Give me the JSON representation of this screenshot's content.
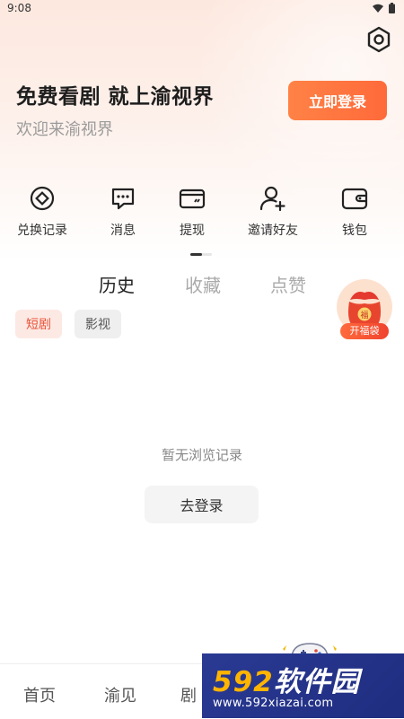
{
  "status_bar": {
    "time": "9:08"
  },
  "header": {
    "promo_title": "免费看剧 就上渝视界",
    "promo_subtitle": "欢迎来渝视界",
    "login_button": "立即登录"
  },
  "shortcuts": [
    {
      "label": "兑换记录",
      "icon": "coin-icon"
    },
    {
      "label": "消息",
      "icon": "message-icon"
    },
    {
      "label": "提现",
      "icon": "card-icon"
    },
    {
      "label": "邀请好友",
      "icon": "add-user-icon"
    },
    {
      "label": "钱包",
      "icon": "wallet-icon"
    }
  ],
  "tabs": [
    {
      "label": "历史",
      "active": true
    },
    {
      "label": "收藏",
      "active": false
    },
    {
      "label": "点赞",
      "active": false
    }
  ],
  "filters": [
    {
      "label": "短剧",
      "active": true
    },
    {
      "label": "影视",
      "active": false
    }
  ],
  "floating_badge": {
    "label": "开福袋",
    "mark": "福"
  },
  "empty_state": {
    "message": "暂无浏览记录",
    "button": "去登录"
  },
  "bottom_nav": [
    {
      "label": "首页"
    },
    {
      "label": "渝见"
    },
    {
      "label": "剧"
    }
  ],
  "watermark": {
    "number": "592",
    "text": "软件园",
    "url": "www.592xiazai.com"
  },
  "colors": {
    "accent": "#ff7340",
    "chip_active_bg": "#fde9e4",
    "chip_active_text": "#e8543a",
    "watermark_bg": "#23328a"
  }
}
